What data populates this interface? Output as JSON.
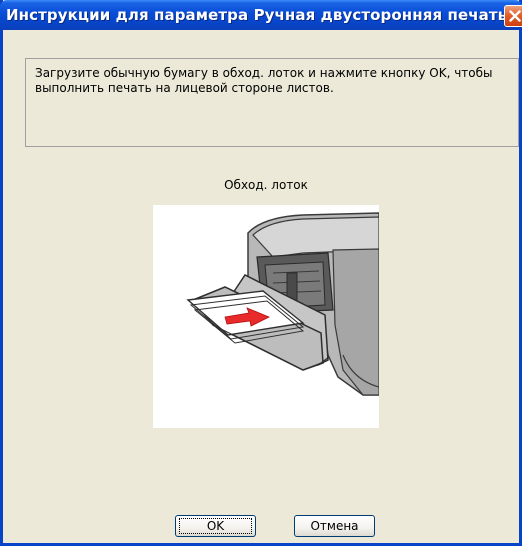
{
  "window": {
    "title": "Инструкции для параметра Ручная двусторонняя печать"
  },
  "message": {
    "text": "Загрузите обычную бумагу в обход. лоток и нажмите кнопку OK, чтобы выполнить печать на лицевой стороне листов."
  },
  "illustration": {
    "caption": "Обход. лоток",
    "icon": "printer-manual-feed-tray-illustration"
  },
  "buttons": {
    "ok_label": "OK",
    "cancel_label": "Отмена"
  },
  "colors": {
    "titlebar": "#0846cc",
    "close_button": "#e2602a",
    "dialog_background": "#ece9d8",
    "arrow": "#e82a2a"
  }
}
